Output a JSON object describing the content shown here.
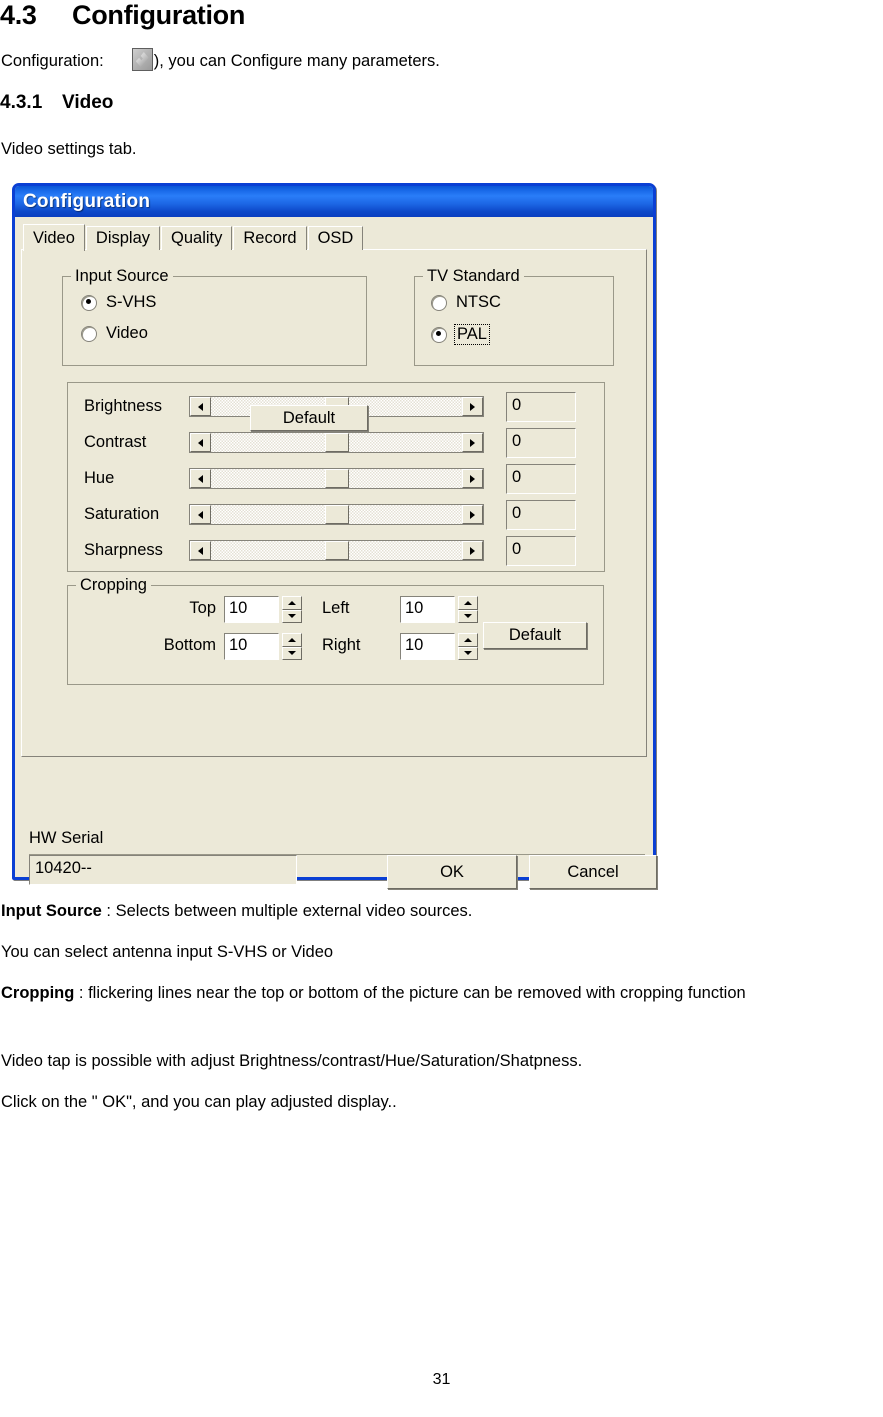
{
  "document": {
    "section_number": "4.3",
    "section_title": "Configuration",
    "intro_prefix": "Configuration:",
    "intro_icon": "wrench-tool-icon",
    "intro_suffix": "), you can Configure many parameters.",
    "subsection_number": "4.3.1",
    "subsection_title": "Video",
    "video_settings_line": "Video settings tab.",
    "page_number": "31",
    "notes": {
      "input_source_term": "Input Source",
      "input_source_desc": " : Selects between multiple external video sources.",
      "antenna_line": " You can select antenna input S-VHS or Video",
      "cropping_term": "Cropping",
      "cropping_desc": " : flickering lines near the top or bottom of the picture can be removed with cropping function",
      "video_tap_line": "Video tap is possible with adjust Brightness/contrast/Hue/Saturation/Shatpness.",
      "click_ok_line": "Click on the \" OK\", and you can play adjusted display.."
    }
  },
  "dialog": {
    "title": "Configuration",
    "accent_color": "#0a3fd4",
    "face_color": "#ece9d8",
    "tabs": [
      {
        "label": "Video",
        "active": true
      },
      {
        "label": "Display",
        "active": false
      },
      {
        "label": "Quality",
        "active": false
      },
      {
        "label": "Record",
        "active": false
      },
      {
        "label": "OSD",
        "active": false
      }
    ],
    "input_source": {
      "legend": "Input Source",
      "options": [
        {
          "label": "S-VHS",
          "checked": true
        },
        {
          "label": "Video",
          "checked": false
        }
      ]
    },
    "tv_standard": {
      "legend": "TV Standard",
      "options": [
        {
          "label": "NTSC",
          "checked": false,
          "focused": false
        },
        {
          "label": "PAL",
          "checked": true,
          "focused": true
        }
      ]
    },
    "adjustments": {
      "sliders": [
        {
          "label": "Brightness",
          "value": "0"
        },
        {
          "label": "Contrast",
          "value": "0"
        },
        {
          "label": "Hue",
          "value": "0"
        },
        {
          "label": "Saturation",
          "value": "0"
        },
        {
          "label": "Sharpness",
          "value": "0"
        }
      ],
      "default_button": "Default"
    },
    "cropping": {
      "legend": "Cropping",
      "fields": [
        {
          "label": "Top",
          "value": "10"
        },
        {
          "label": "Bottom",
          "value": "10"
        },
        {
          "label": "Left",
          "value": "10"
        },
        {
          "label": "Right",
          "value": "10"
        }
      ],
      "default_button": "Default"
    },
    "hw_serial": {
      "label": "HW Serial",
      "value": "10420--"
    },
    "footer": {
      "ok": "OK",
      "cancel": "Cancel"
    }
  }
}
